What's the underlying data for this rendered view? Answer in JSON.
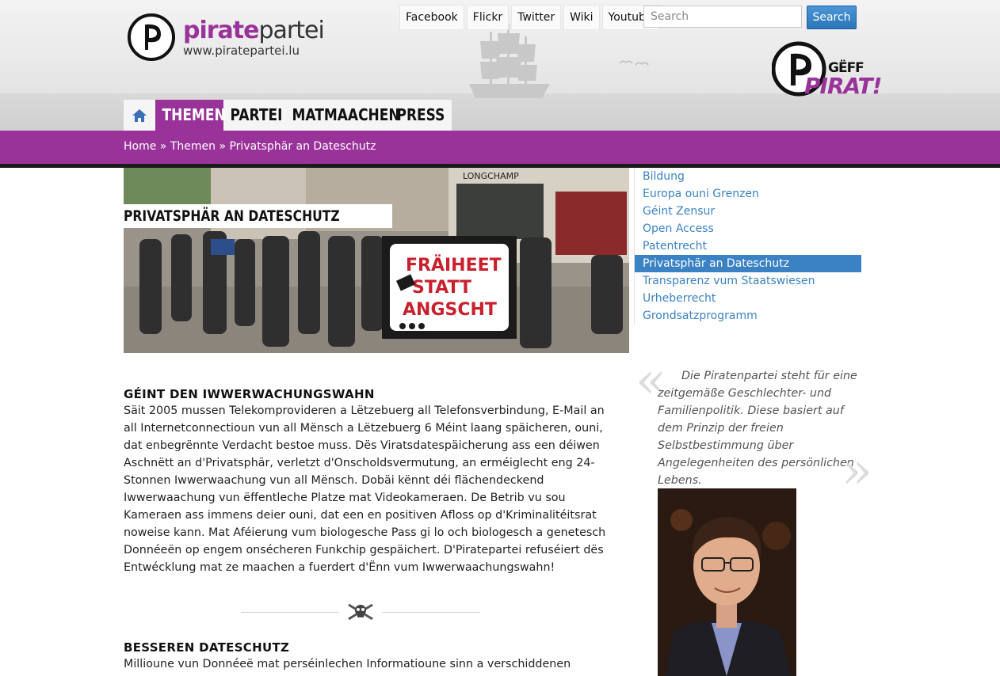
{
  "site": {
    "name_part1": "pirate",
    "name_part2": "partei",
    "url": "www.piratepartei.lu"
  },
  "social_links": [
    "Facebook",
    "Flickr",
    "Twitter",
    "Wiki",
    "Youtube"
  ],
  "search": {
    "placeholder": "Search",
    "button_label": "Search"
  },
  "badge": {
    "line1": "GËFF",
    "line2": "PIRAT!"
  },
  "nav": {
    "items": [
      {
        "label": "THEMEN",
        "active": true
      },
      {
        "label": "PARTEI",
        "active": false
      },
      {
        "label": "MATMAACHEN",
        "active": false
      },
      {
        "label": "PRESS",
        "active": false
      }
    ]
  },
  "breadcrumb": {
    "home": "Home",
    "sep": "»",
    "section": "Themen",
    "current": "Privatsphär an Dateschutz"
  },
  "hero": {
    "title": "PRIVATSPHÄR AN DATESCHUTZ",
    "banner_line1": "FRÄIHEET",
    "banner_line2": "STATT",
    "banner_line3": "ANGSCHT",
    "shop_sign": "LONGCHAMP"
  },
  "article": {
    "heading1": "GÉINT DEN IWWERWACHUNGSWAHN",
    "body1": "Säit 2005 mussen Telekomprovideren a Lëtzebuerg all Telefonsverbindung, E-Mail an all Internetconnectioun vun all Mënsch a Lëtzebuerg 6 Méint laang späicheren, ouni, dat enbegrënnte Verdacht bestoe muss. Dës Viratsdatespäicherung ass een déiwen Aschnëtt an d'Privatsphär, verletzt d'Onscholdsvermutung, an erméiglecht eng 24-Stonnen Iwwerwaachung vun all Mënsch. Dobäi kënnt déi flächendeckend Iwwerwaachung vun ëffentleche Platze mat Videokameraen. De Betrib vu sou Kameraen ass immens deier ouni, dat een en positiven Afloss op d'Kriminalitéitsrat noweise kann. Mat Aféierung vum biologesche Pass gi lo och biologesch a genetesch Donnéeën op engem onsécheren Funkchip gespäichert. D'Piratepartei refuséiert dës Entwécklung mat ze maachen a fuerdert d'Ënn vum Iwwerwaachungswahn!",
    "heading2": "BESSEREN DATESCHUTZ",
    "body2": "Millioune vun Donnéeë mat perséinlechen Informatioune sinn a verschiddenen"
  },
  "sidebar": {
    "items": [
      {
        "label": "Bildung",
        "active": false
      },
      {
        "label": "Europa ouni Grenzen",
        "active": false
      },
      {
        "label": "Géint Zensur",
        "active": false
      },
      {
        "label": "Open Access",
        "active": false
      },
      {
        "label": "Patentrecht",
        "active": false
      },
      {
        "label": "Privatsphär an Dateschutz",
        "active": true
      },
      {
        "label": "Transparenz vum Staatswiesen",
        "active": false
      },
      {
        "label": "Urheberrecht",
        "active": false
      },
      {
        "label": "Grondsatzprogramm",
        "active": false
      }
    ],
    "quote": "Die Piratenpartei steht für eine zeitgemäße Geschlechter- und Familienpolitik. Diese basiert auf dem Prinzip der freien Selbstbestimmung über Angelegenheiten des persönlichen Lebens.",
    "quote_open": "«",
    "quote_close": "»"
  },
  "colors": {
    "brand_purple": "#993399",
    "link_blue": "#3b82c4",
    "search_button": "#2a74b8"
  },
  "icons": [
    "pirate-party-logo-icon",
    "home-icon",
    "ship-icon",
    "skull-crossbones-icon",
    "geff-pirat-badge-icon"
  ]
}
